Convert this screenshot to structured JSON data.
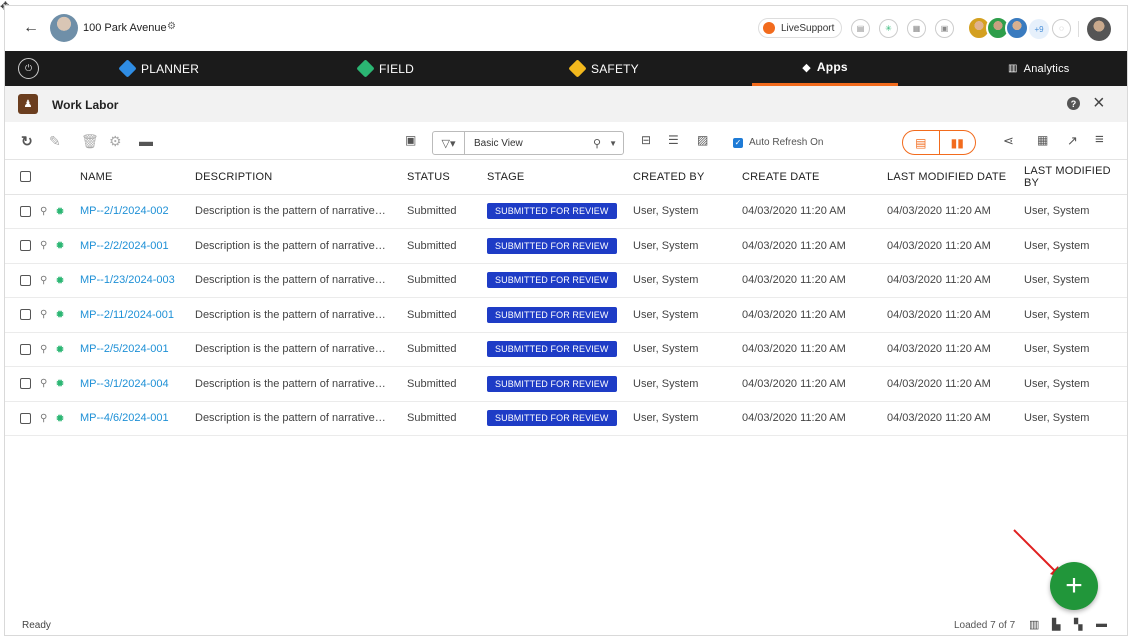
{
  "top": {
    "project_name": "100 Park Avenue",
    "livesupport_label": "LiveSupport",
    "more_users": "+9"
  },
  "nav": {
    "items": [
      {
        "label": "PLANNER",
        "color": "#2f8de4"
      },
      {
        "label": "FIELD",
        "color": "#2bb673"
      },
      {
        "label": "SAFETY",
        "color": "#f2b81d"
      },
      {
        "label": "Apps",
        "color": "#ffffff"
      },
      {
        "label": "Analytics",
        "color": "#ffffff"
      }
    ],
    "active": "Apps",
    "accent": "#f26b1d"
  },
  "module": {
    "title": "Work Labor"
  },
  "toolbar": {
    "view_name": "Basic View",
    "auto_refresh_label": "Auto Refresh On"
  },
  "table": {
    "headers": [
      "NAME",
      "DESCRIPTION",
      "STATUS",
      "STAGE",
      "CREATED BY",
      "CREATE DATE",
      "LAST MODIFIED DATE",
      "LAST MODIFIED BY"
    ],
    "rows": [
      {
        "name": "MP--2/1/2024-002",
        "description": "Description is the pattern of narrative…",
        "status": "Submitted",
        "stage": "SUBMITTED FOR REVIEW",
        "created_by": "User, System",
        "create_date": "04/03/2020  11:20 AM",
        "modified_date": "04/03/2020  11:20 AM",
        "modified_by": "User, System"
      },
      {
        "name": "MP--2/2/2024-001",
        "description": "Description is the pattern of narrative…",
        "status": "Submitted",
        "stage": "SUBMITTED FOR REVIEW",
        "created_by": "User, System",
        "create_date": "04/03/2020  11:20 AM",
        "modified_date": "04/03/2020  11:20 AM",
        "modified_by": "User, System"
      },
      {
        "name": "MP--1/23/2024-003",
        "description": "Description is the pattern of narrative…",
        "status": "Submitted",
        "stage": "SUBMITTED FOR REVIEW",
        "created_by": "User, System",
        "create_date": "04/03/2020  11:20 AM",
        "modified_date": "04/03/2020  11:20 AM",
        "modified_by": "User, System"
      },
      {
        "name": "MP--2/11/2024-001",
        "description": "Description is the pattern of narrative…",
        "status": "Submitted",
        "stage": "SUBMITTED FOR REVIEW",
        "created_by": "User, System",
        "create_date": "04/03/2020  11:20 AM",
        "modified_date": "04/03/2020  11:20 AM",
        "modified_by": "User, System"
      },
      {
        "name": "MP--2/5/2024-001",
        "description": "Description is the pattern of narrative…",
        "status": "Submitted",
        "stage": "SUBMITTED FOR REVIEW",
        "created_by": "User, System",
        "create_date": "04/03/2020  11:20 AM",
        "modified_date": "04/03/2020  11:20 AM",
        "modified_by": "User, System"
      },
      {
        "name": "MP--3/1/2024-004",
        "description": "Description is the pattern of narrative…",
        "status": "Submitted",
        "stage": "SUBMITTED FOR REVIEW",
        "created_by": "User, System",
        "create_date": "04/03/2020  11:20 AM",
        "modified_date": "04/03/2020  11:20 AM",
        "modified_by": "User, System"
      },
      {
        "name": "MP--4/6/2024-001",
        "description": "Description is the pattern of narrative…",
        "status": "Submitted",
        "stage": "SUBMITTED FOR REVIEW",
        "created_by": "User, System",
        "create_date": "04/03/2020  11:20 AM",
        "modified_date": "04/03/2020  11:20 AM",
        "modified_by": "User, System"
      }
    ]
  },
  "status_bar": {
    "status": "Ready",
    "loaded": "Loaded 7 of 7"
  },
  "icons": {
    "fab": "plus-icon",
    "annotation": "red-arrow"
  },
  "colors": {
    "stage_badge": "#1e3cc6",
    "link": "#1e90d6",
    "fab": "#21963a",
    "accent": "#f26b1d"
  }
}
